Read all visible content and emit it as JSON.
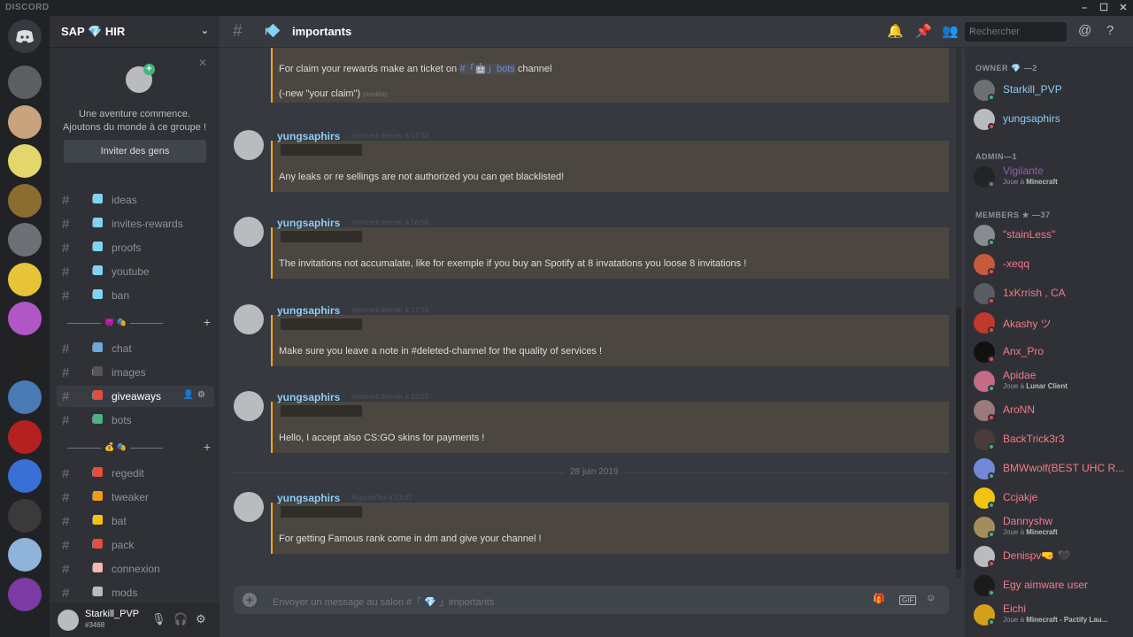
{
  "app": {
    "brand": "DISCORD"
  },
  "window": {
    "minimize": "–",
    "maximize": "☐",
    "close": "✕"
  },
  "guild": {
    "name": "SAP 💎 HIR",
    "chevron": "⌄"
  },
  "invite": {
    "line1": "Une aventure commence.",
    "line2": "Ajoutons du monde à ce groupe !",
    "button": "Inviter des gens",
    "close": "✕"
  },
  "channels": [
    {
      "label": "ideas",
      "emoji": "💎"
    },
    {
      "label": "invites-rewards",
      "emoji": "💎"
    },
    {
      "label": "proofs",
      "emoji": "💎"
    },
    {
      "label": "youtube",
      "emoji": "💎"
    },
    {
      "label": "ban",
      "emoji": "💎"
    },
    {
      "label": "chat",
      "emoji": "🗡"
    },
    {
      "label": "images",
      "emoji": "💣"
    },
    {
      "label": "giveaways",
      "emoji": "🔺"
    },
    {
      "label": "bots",
      "emoji": "🤖"
    },
    {
      "label": "regedit",
      "emoji": "🆘"
    },
    {
      "label": "tweaker",
      "emoji": "🔥"
    },
    {
      "label": "bat",
      "emoji": "🔔"
    },
    {
      "label": "pack",
      "emoji": "🔴"
    },
    {
      "label": "connexion",
      "emoji": "🍣"
    },
    {
      "label": "mods",
      "emoji": "💍"
    }
  ],
  "categories": [
    {
      "mid": "😈 🎭",
      "add": "+"
    },
    {
      "mid": "💰 🎭",
      "add": "+"
    }
  ],
  "user": {
    "name": "Starkill_PVP",
    "tag": "#3468"
  },
  "chat": {
    "channel": "importants",
    "emoji": "💎",
    "bracket": "「",
    "input_placeholder": "Envoyer un message au salon #「 💎 」importants",
    "day_divider": "28 juin 2019",
    "top_line1_pre": "For claim your rewards make an ticket on ",
    "top_line1_chan": "#「🤖」bots",
    "top_line1_post": " channel",
    "top_line2": "(-new \"your claim\")",
    "top_line2_edit": "(modifié)",
    "messages": [
      {
        "author": "yungsaphirs",
        "ts": "mercredi dernier à 14:52",
        "text": "Any leaks or re sellings are not authorized you can get blacklisted!"
      },
      {
        "author": "yungsaphirs",
        "ts": "mercredi dernier à 16:56",
        "text": "The invitations not accumalate, like for exemple if you buy an Spotify at 8 invatations you loose 8 invitations !"
      },
      {
        "author": "yungsaphirs",
        "ts": "mercredi dernier à 17:03",
        "text": "Make sure you leave a note in #deleted-channel  for the quality of services !"
      },
      {
        "author": "yungsaphirs",
        "ts": "mercredi dernier à 22:52",
        "text": "Hello, I accept also CS:GO skins for payments !"
      },
      {
        "author": "yungsaphirs",
        "ts": "Aujourd'hui à 13:37",
        "text": "For getting Famous rank come in dm and give your channel !"
      }
    ]
  },
  "search": {
    "placeholder": "Rechercher"
  },
  "member_groups": {
    "owner": "OWNER 💎 —2",
    "admin": "ADMIN—1",
    "members": "MEMBERS ★ —37"
  },
  "members": [
    {
      "name": "Starkill_PVP",
      "color": "#8ecdf8",
      "status": "#43b581",
      "avatar": "#6d6f73"
    },
    {
      "name": "yungsaphirs",
      "color": "#8ecdf8",
      "status": "#f04747",
      "avatar": "#b9bbbe"
    },
    {
      "name": "Vigilante",
      "color": "#9b59b6",
      "status": "#747f8d",
      "avatar": "#232428",
      "activity_pre": "Joue à ",
      "activity_game": "Minecraft"
    },
    {
      "name": "\"stainLess\"",
      "color": "#f47b8a",
      "status": "#43b581",
      "avatar": "#888b90"
    },
    {
      "name": "-xeqq",
      "color": "#f47b8a",
      "status": "#f04747",
      "avatar": "#c85a3c"
    },
    {
      "name": "1xKrrish , CA",
      "color": "#f47b8a",
      "status": "#f04747",
      "avatar": "#5a5d63"
    },
    {
      "name": "Akashy ツ",
      "color": "#f47b8a",
      "status": "#f04747",
      "avatar": "#c0392b"
    },
    {
      "name": "Anx_Pro",
      "color": "#f47b8a",
      "status": "#f04747",
      "avatar": "#111111"
    },
    {
      "name": "Apidae",
      "color": "#f47b8a",
      "status": "#43b581",
      "avatar": "#c56b87",
      "activity_pre": "Joue à ",
      "activity_game": "Lunar Client"
    },
    {
      "name": "AroNN",
      "color": "#f47b8a",
      "status": "#f04747",
      "avatar": "#9a7a7a"
    },
    {
      "name": "BackTrick3r3",
      "color": "#f47b8a",
      "status": "#43b581",
      "avatar": "#4a3c3a"
    },
    {
      "name": "BMWwolf(BEST UHC R...",
      "color": "#f47b8a",
      "status": "#43b581",
      "avatar": "#7289da"
    },
    {
      "name": "Ccjakje",
      "color": "#f47b8a",
      "status": "#43b581",
      "avatar": "#f1c40f"
    },
    {
      "name": "Dannyshw",
      "color": "#f47b8a",
      "status": "#43b581",
      "avatar": "#a58c5c",
      "activity_pre": "Joue à ",
      "activity_game": "Minecraft"
    },
    {
      "name": "Denispv🤜 🖤",
      "color": "#f47b8a",
      "status": "#f04747",
      "avatar": "#b9bbbe"
    },
    {
      "name": "Egy aimware user",
      "color": "#f47b8a",
      "status": "#43b581",
      "avatar": "#1b1b1b"
    },
    {
      "name": "Eichi",
      "color": "#f47b8a",
      "status": "#43b581",
      "avatar": "#d4a017",
      "activity_pre": "Joue à ",
      "activity_game": "Minecraft - Pactify Lau..."
    }
  ],
  "servers": [
    "#5d5f62",
    "#c9a27e",
    "#e3d66b",
    "#8a6d2f",
    "#6c6f75",
    "#e7c33a",
    "#b255c7",
    "#222222",
    "#4a7ab5",
    "#b52020",
    "#3a6fd6",
    "#3a3a3a",
    "#8fb3d9",
    "#7c3aa5"
  ]
}
